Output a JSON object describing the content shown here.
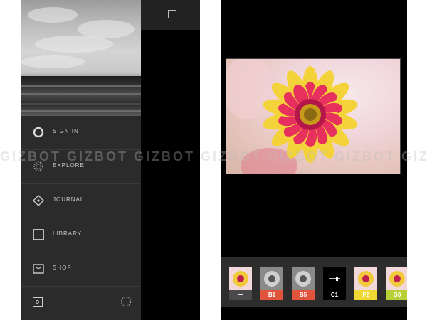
{
  "menu": {
    "items": [
      {
        "label": "SIGN IN",
        "icon": "circle-icon"
      },
      {
        "label": "EXPLORE",
        "icon": "dotted-circle-icon"
      },
      {
        "label": "JOURNAL",
        "icon": "diamond-icon"
      },
      {
        "label": "LIBRARY",
        "icon": "square-icon"
      },
      {
        "label": "SHOP",
        "icon": "shop-box-icon"
      }
    ]
  },
  "bottom_bar": {
    "left_icon": "settings-icon",
    "right_icon": "spinner-icon"
  },
  "filters": [
    {
      "label": "—",
      "color": "#4a4a4a",
      "tone": "color"
    },
    {
      "label": "B1",
      "color": "#e0543c",
      "tone": "mono"
    },
    {
      "label": "B5",
      "color": "#e0543c",
      "tone": "mono"
    },
    {
      "label": "C1",
      "color": "#000000",
      "tone": "selected"
    },
    {
      "label": "F2",
      "color": "#f0d834",
      "tone": "color"
    },
    {
      "label": "G3",
      "color": "#b6d035",
      "tone": "color"
    }
  ],
  "watermark": "GIZBOT GIZBOT GIZBOT GIZBOT GIZBOT GIZBOT GIZBOT"
}
